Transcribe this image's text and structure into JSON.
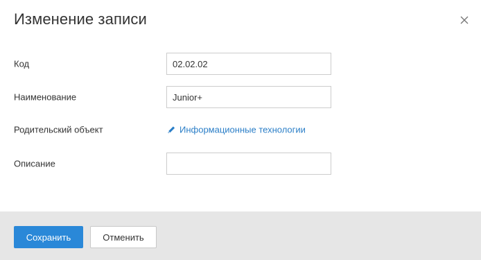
{
  "dialog": {
    "title": "Изменение записи",
    "close_icon": "close-icon"
  },
  "form": {
    "code": {
      "label": "Код",
      "value": "02.02.02"
    },
    "name": {
      "label": "Наименование",
      "value": "Junior+"
    },
    "parent": {
      "label": "Родительский объект",
      "value": "Информационные технологии",
      "icon": "pencil-icon"
    },
    "description": {
      "label": "Описание",
      "value": ""
    }
  },
  "footer": {
    "save_label": "Сохранить",
    "cancel_label": "Отменить"
  },
  "colors": {
    "primary": "#2a88d8",
    "link": "#2a7ec7",
    "footer_bg": "#e6e6e6"
  }
}
